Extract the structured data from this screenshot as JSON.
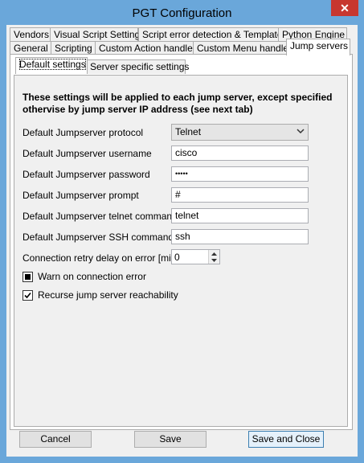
{
  "window": {
    "title": "PGT Configuration",
    "close_glyph": "✕"
  },
  "tabs_row1": [
    "Vendors",
    "Visual Script Settings",
    "Script error detection & Templates",
    "Python Engine"
  ],
  "tabs_row2": [
    "General",
    "Scripting",
    "Custom Action handlers",
    "Custom Menu handlers",
    "Jump servers"
  ],
  "active_tab": "Jump servers",
  "subtabs": [
    "Default settings",
    "Server specific settings"
  ],
  "active_subtab": "Default settings",
  "info": "These settings will be applied to each jump server, except specified othervise by jump server IP address (see next tab)",
  "fields": {
    "protocol": {
      "label": "Default Jumpserver protocol",
      "value": "Telnet"
    },
    "username": {
      "label": "Default Jumpserver username",
      "value": "cisco"
    },
    "password": {
      "label": "Default Jumpserver password",
      "value": "•••••"
    },
    "prompt": {
      "label": "Default Jumpserver prompt",
      "value": "#"
    },
    "telnet_command": {
      "label": "Default Jumpserver telnet command",
      "value": "telnet"
    },
    "ssh_command": {
      "label": "Default Jumpserver SSH command",
      "value": "ssh"
    },
    "retry_delay": {
      "label": "Connection retry delay on error [min] :",
      "value": "0"
    }
  },
  "checkboxes": {
    "warn": {
      "label": "Warn on connection error",
      "state": "indeterminate"
    },
    "recurse": {
      "label": "Recurse jump server reachability",
      "state": "checked"
    }
  },
  "buttons": {
    "cancel": "Cancel",
    "save": "Save",
    "save_close": "Save and Close"
  },
  "colors": {
    "titlebar": "#6aa7da",
    "close": "#c7372f",
    "client": "#f0f0f0"
  }
}
